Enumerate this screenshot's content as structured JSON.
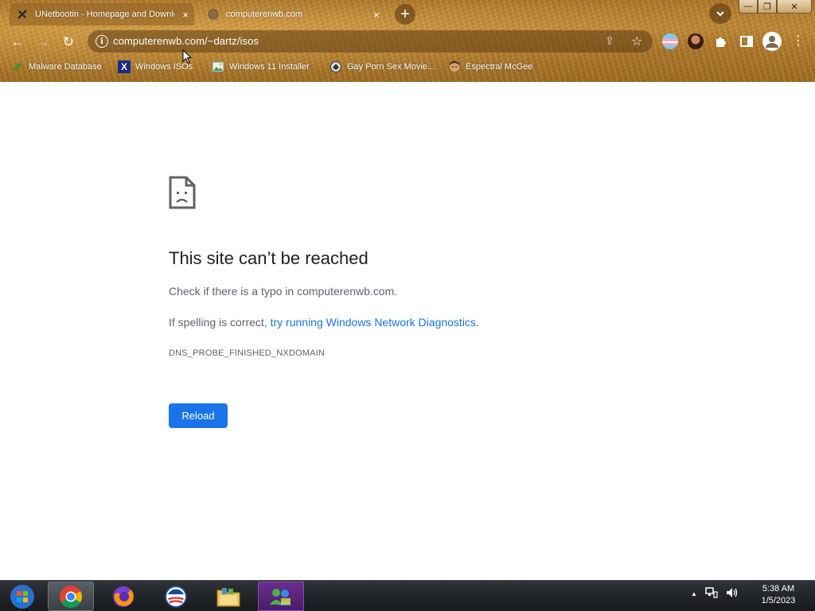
{
  "tabs": [
    {
      "title": "UNetbootin - Homepage and Downloads",
      "close": "×",
      "icon": "unetbootin-icon",
      "active": true
    },
    {
      "title": "computerenwb.com",
      "close": "×",
      "icon": "globe-icon",
      "active": false
    }
  ],
  "new_tab": "+",
  "window_controls": {
    "minimize": "—",
    "maximize": "❐",
    "close": "✕"
  },
  "nav": {
    "back": "←",
    "forward": "→",
    "reload": "↻"
  },
  "omnibox": {
    "url": "computerenwb.com/~dartz/isos",
    "info": "i",
    "share": "⇪",
    "star": "☆"
  },
  "bookmarks": [
    {
      "label": "Malware Database",
      "icon": "leaf-icon"
    },
    {
      "label": "Windows ISOs",
      "icon": "x-icon"
    },
    {
      "label": "Windows 11 Installer",
      "icon": "image-icon"
    },
    {
      "label": "Gay Porn Sex Movie...",
      "icon": "bird-icon"
    },
    {
      "label": "Espectral McGee",
      "icon": "face-icon"
    }
  ],
  "error": {
    "title": "This site can’t be reached",
    "line1": "Check if there is a typo in computerenwb.com.",
    "line2_prefix": "If spelling is correct, ",
    "line2_link": "try running Windows Network Diagnostics",
    "line2_suffix": ".",
    "code": "DNS_PROBE_FINISHED_NXDOMAIN",
    "reload": "Reload"
  },
  "taskbar": {
    "apps": [
      "start-orb-icon",
      "chrome-icon",
      "firefox-icon",
      "obama-logo-icon",
      "file-explorer-icon",
      "messenger-icon"
    ],
    "tray": {
      "show_hidden": "▲"
    },
    "time": "5:38 AM",
    "date": "1/5/2023"
  },
  "colors": {
    "accent": "#1a73e8",
    "title": "#202124",
    "body": "#5f6368",
    "frame": "#b07d2f"
  }
}
